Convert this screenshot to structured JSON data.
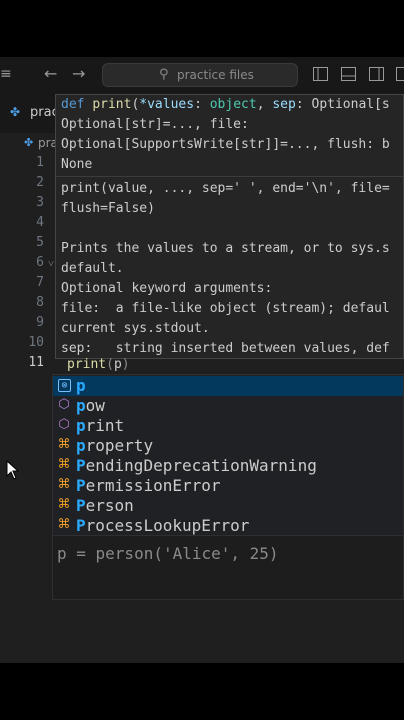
{
  "titlebar": {
    "search_placeholder": "practice files",
    "icons": [
      "menu-icon",
      "back-arrow-icon",
      "forward-arrow-icon",
      "search-icon",
      "layout-sidebar-left-icon",
      "layout-panel-icon",
      "layout-sidebar-right-icon",
      "layout-customize-icon"
    ]
  },
  "tab": {
    "label": "prac"
  },
  "breadcrumb": {
    "label": "pra"
  },
  "gutter": {
    "lines": [
      "1",
      "2",
      "3",
      "4",
      "5",
      "6",
      "7",
      "8",
      "9",
      "10",
      "11"
    ]
  },
  "hover": {
    "signature_lines": [
      "def print(*values: object, sep: Optional[s",
      "Optional[str]=..., file:",
      "Optional[SupportsWrite[str]]=..., flush: b",
      "None"
    ],
    "doc_lines": [
      "print(value, ..., sep=' ', end='\\n', file=",
      "flush=False)",
      "",
      "Prints the values to a stream, or to sys.s",
      "default.",
      "Optional keyword arguments:",
      "file:  a file-like object (stream); defaul",
      "current sys.stdout.",
      "sep:   string inserted between values, def"
    ]
  },
  "editor": {
    "line11": {
      "fn": "print",
      "open": "(",
      "typed": "p",
      "close": ")"
    }
  },
  "suggest": {
    "typed": "p",
    "items": [
      {
        "label": "p",
        "kind": "variable"
      },
      {
        "label": "pow",
        "kind": "function"
      },
      {
        "label": "print",
        "kind": "function"
      },
      {
        "label": "property",
        "kind": "class"
      },
      {
        "label": "PendingDeprecationWarning",
        "kind": "class"
      },
      {
        "label": "PermissionError",
        "kind": "class"
      },
      {
        "label": "Person",
        "kind": "class"
      },
      {
        "label": "ProcessLookupError",
        "kind": "class"
      }
    ],
    "detail": "p = person('Alice', 25)"
  }
}
